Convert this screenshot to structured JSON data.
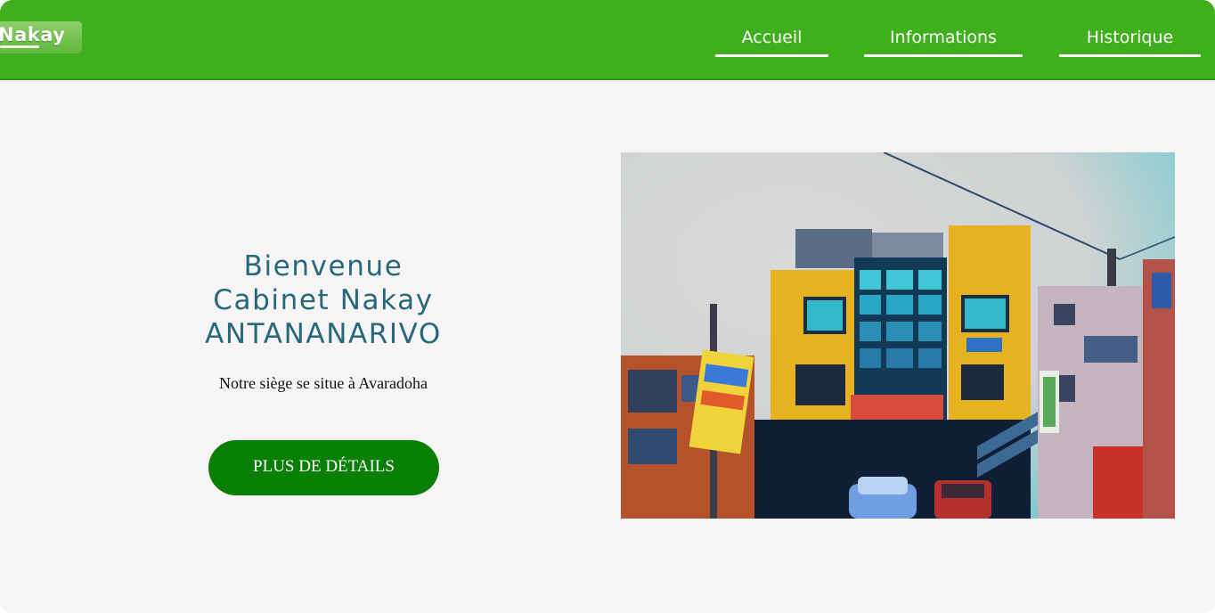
{
  "header": {
    "logo_text": "Nakay",
    "nav": [
      {
        "label": "Accueil"
      },
      {
        "label": "Informations"
      },
      {
        "label": "Historique"
      }
    ]
  },
  "hero": {
    "title_line1": "Bienvenue",
    "title_line2": "Cabinet Nakay",
    "title_line3": "ANTANANARIVO",
    "subtitle": "Notre siège se situe à Avaradoha",
    "cta_label": "PLUS DE DÉTAILS"
  },
  "colors": {
    "header_bg": "#3faf1e",
    "title_color": "#27697a",
    "cta_bg": "#0a7f06",
    "page_bg": "#f6f4f5"
  }
}
